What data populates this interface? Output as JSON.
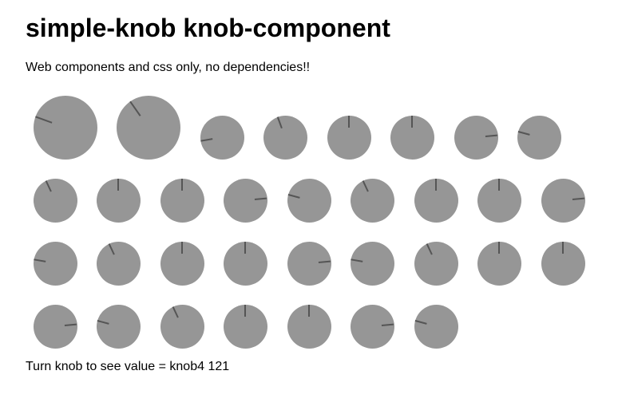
{
  "header": {
    "title": "simple-knob knob-component",
    "subtitle": "Web components and css only, no dependencies!!"
  },
  "status": {
    "prefix": "Turn knob to see value = ",
    "knob_name": "knob4",
    "value": "121"
  },
  "colors": {
    "knob_body": "#969696",
    "pointer": "#555555"
  },
  "knobs": [
    {
      "id": "knob-1",
      "angle_deg": -70
    },
    {
      "id": "knob-2",
      "angle_deg": -35
    },
    {
      "id": "knob-3",
      "angle_deg": -100
    },
    {
      "id": "knob-4",
      "angle_deg": -20
    },
    {
      "id": "knob-5",
      "angle_deg": 0
    },
    {
      "id": "knob-6",
      "angle_deg": 0
    },
    {
      "id": "knob-7",
      "angle_deg": 85
    },
    {
      "id": "knob-8",
      "angle_deg": -75
    },
    {
      "id": "knob-9",
      "angle_deg": -25
    },
    {
      "id": "knob-10",
      "angle_deg": 0
    },
    {
      "id": "knob-11",
      "angle_deg": 0
    },
    {
      "id": "knob-12",
      "angle_deg": 85
    },
    {
      "id": "knob-13",
      "angle_deg": -75
    },
    {
      "id": "knob-14",
      "angle_deg": -25
    },
    {
      "id": "knob-15",
      "angle_deg": 0
    },
    {
      "id": "knob-16",
      "angle_deg": 0
    },
    {
      "id": "knob-17",
      "angle_deg": 85
    },
    {
      "id": "knob-18",
      "angle_deg": -80
    },
    {
      "id": "knob-19",
      "angle_deg": -25
    },
    {
      "id": "knob-20",
      "angle_deg": 0
    },
    {
      "id": "knob-21",
      "angle_deg": 0
    },
    {
      "id": "knob-22",
      "angle_deg": 85
    },
    {
      "id": "knob-23",
      "angle_deg": -80
    },
    {
      "id": "knob-24",
      "angle_deg": -25
    },
    {
      "id": "knob-25",
      "angle_deg": 0
    },
    {
      "id": "knob-26",
      "angle_deg": 0
    },
    {
      "id": "knob-27",
      "angle_deg": 85
    },
    {
      "id": "knob-28",
      "angle_deg": -75
    },
    {
      "id": "knob-29",
      "angle_deg": -25
    },
    {
      "id": "knob-30",
      "angle_deg": 0
    },
    {
      "id": "knob-31",
      "angle_deg": 0
    },
    {
      "id": "knob-32",
      "angle_deg": 85
    },
    {
      "id": "knob-33",
      "angle_deg": -75
    }
  ]
}
